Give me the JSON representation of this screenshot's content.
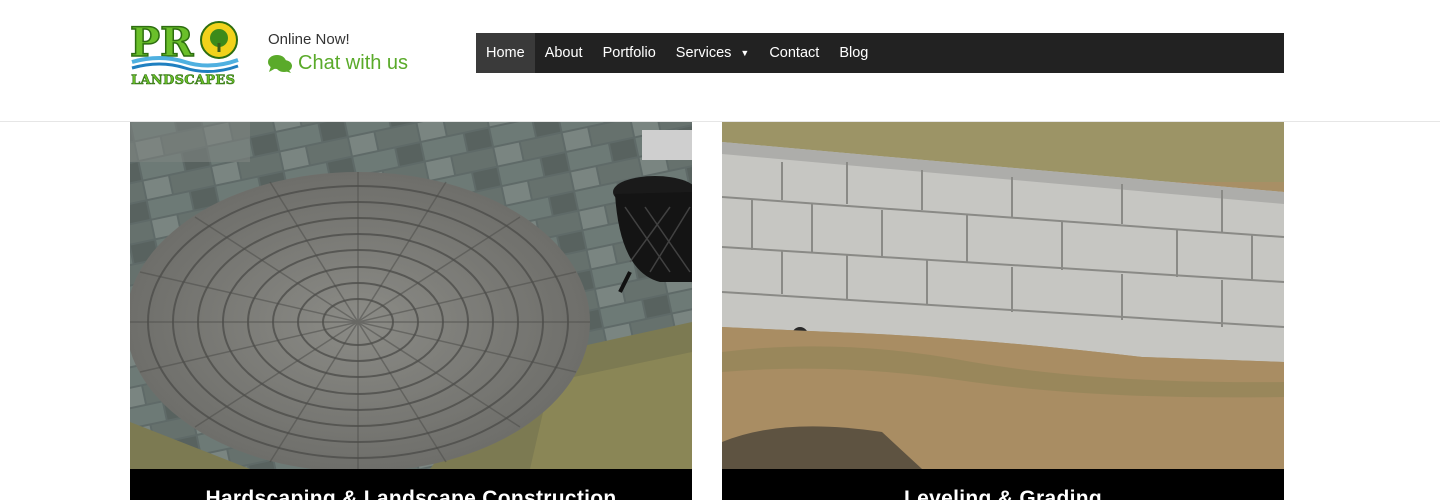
{
  "header": {
    "logo": {
      "word": "PRO",
      "sub": "LANDSCAPES"
    },
    "online_text": "Online Now!",
    "chat_text": "Chat with us"
  },
  "nav": {
    "items": [
      {
        "label": "Home",
        "active": true
      },
      {
        "label": "About"
      },
      {
        "label": "Portfolio"
      },
      {
        "label": "Services",
        "has_dropdown": true
      },
      {
        "label": "Contact"
      },
      {
        "label": "Blog"
      }
    ],
    "caret_icon": "▼"
  },
  "cards": [
    {
      "caption": "Hardscaping & Landscape Construction"
    },
    {
      "caption": "Leveling & Grading"
    }
  ],
  "colors": {
    "nav_bg": "#222222",
    "chat_green": "#5aaa2a",
    "caption_bg": "#000000"
  }
}
